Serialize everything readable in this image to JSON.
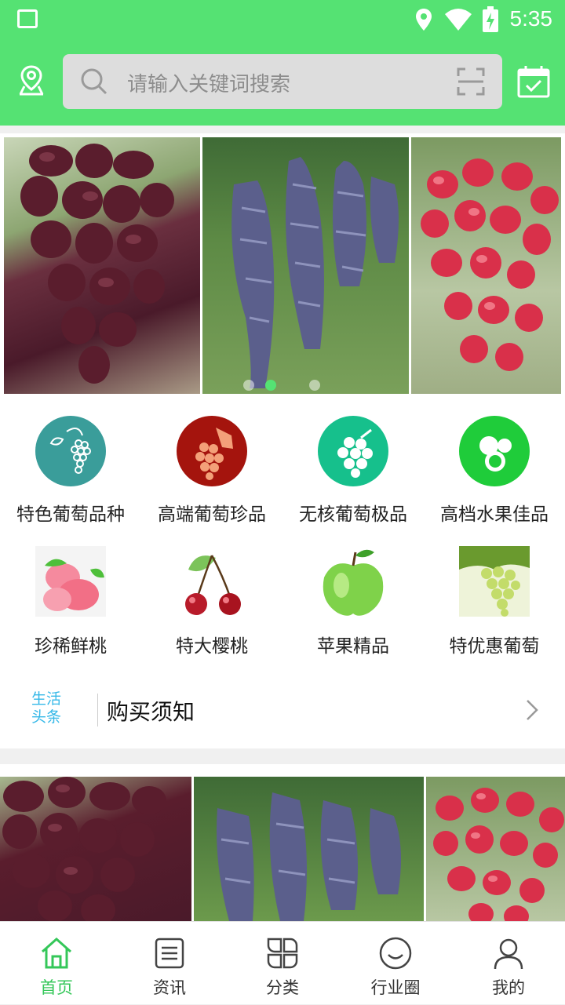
{
  "status_bar": {
    "time": "5:35"
  },
  "search": {
    "placeholder": "请输入关键词搜索"
  },
  "categories": [
    {
      "label": "特色葡萄品种"
    },
    {
      "label": "高端葡萄珍品"
    },
    {
      "label": "无核葡萄极品"
    },
    {
      "label": "高档水果佳品"
    },
    {
      "label": "珍稀鲜桃"
    },
    {
      "label": "特大樱桃"
    },
    {
      "label": "苹果精品"
    },
    {
      "label": "特优惠葡萄"
    }
  ],
  "news": {
    "tag": "生活头条",
    "title": "购买须知"
  },
  "tabs": [
    {
      "label": "首页"
    },
    {
      "label": "资讯"
    },
    {
      "label": "分类"
    },
    {
      "label": "行业圈"
    },
    {
      "label": "我的"
    }
  ],
  "colors": {
    "brand": "#55e273",
    "active_tab": "#34c759",
    "tag": "#35b8e8"
  }
}
